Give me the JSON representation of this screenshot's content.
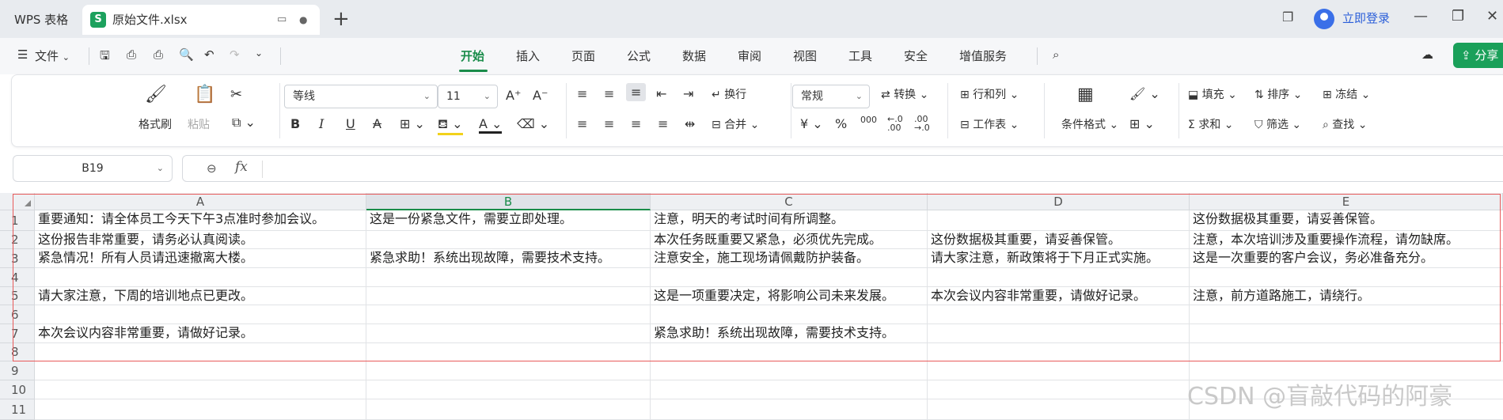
{
  "tabs": {
    "home_label": "WPS 表格",
    "file_label": "原始文件.xlsx",
    "file_badge": "S"
  },
  "titlebar": {
    "login_label": "立即登录"
  },
  "menubar": {
    "file_label": "文件",
    "items": [
      "开始",
      "插入",
      "页面",
      "公式",
      "数据",
      "审阅",
      "视图",
      "工具",
      "安全",
      "增值服务"
    ],
    "active": "开始",
    "share_label": "分享"
  },
  "ribbon": {
    "format_painter": "格式刷",
    "paste": "粘贴",
    "font_name": "等线",
    "font_size": "11",
    "wrap_text": "换行",
    "merge": "合并",
    "number_format": "常规",
    "convert": "转换",
    "rows_cols": "行和列",
    "worksheet": "工作表",
    "conditional_format": "条件格式",
    "fill": "填充",
    "sort": "排序",
    "freeze": "冻结",
    "sum": "求和",
    "filter": "筛选",
    "find": "查找",
    "bold": "B",
    "italic": "I",
    "underline": "U",
    "strikethrough": "A",
    "currency": "¥",
    "percent": "%",
    "thousands": "000",
    "inc_decimal": "←.0 .00",
    "dec_decimal": ".00 →.0"
  },
  "formula_bar": {
    "cell_ref": "B19",
    "fx": "fx",
    "value": ""
  },
  "grid": {
    "columns": [
      "A",
      "B",
      "C",
      "D",
      "E"
    ],
    "selected_column": "B",
    "rows": [
      "1",
      "2",
      "3",
      "4",
      "5",
      "6",
      "7",
      "8",
      "9",
      "10",
      "11"
    ],
    "cells": {
      "A1": "重要通知：请全体员工今天下午3点准时参加会议。",
      "B1": "这是一份紧急文件，需要立即处理。",
      "C1": "注意，明天的考试时间有所调整。",
      "E1": "这份数据极其重要，请妥善保管。",
      "A2": "这份报告非常重要，请务必认真阅读。",
      "C2": "本次任务既重要又紧急，必须优先完成。",
      "D2": "这份数据极其重要，请妥善保管。",
      "E2": "注意，本次培训涉及重要操作流程，请勿缺席。",
      "A3": "紧急情况！所有人员请迅速撤离大楼。",
      "B3": "紧急求助！系统出现故障，需要技术支持。",
      "C3": "注意安全，施工现场请佩戴防护装备。",
      "D3": "请大家注意，新政策将于下月正式实施。",
      "E3": "这是一次重要的客户会议，务必准备充分。",
      "A5": "请大家注意，下周的培训地点已更改。",
      "C5": "这是一项重要决定，将影响公司未来发展。",
      "D5": "本次会议内容非常重要，请做好记录。",
      "E5": "注意，前方道路施工，请绕行。",
      "A7": "本次会议内容非常重要，请做好记录。",
      "C7": "紧急求助！系统出现故障，需要技术支持。"
    }
  },
  "watermark": "CSDN @盲敲代码的阿豪"
}
